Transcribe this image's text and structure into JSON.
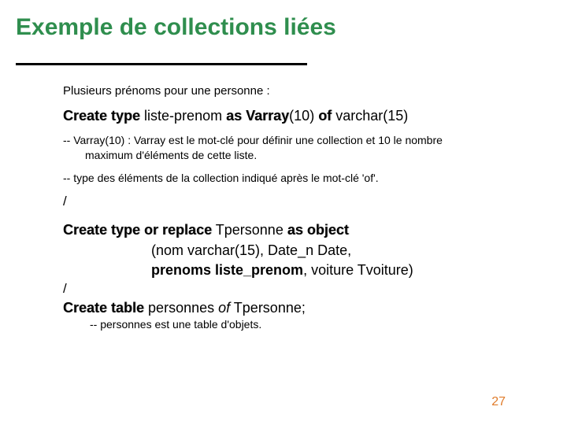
{
  "title": "Exemple de collections liées",
  "intro": "Plusieurs prénoms pour une personne :",
  "stmt1": {
    "create_type": "Create type",
    "name": " liste-prenom ",
    "as_varray": "as Varray",
    "size": "(10) ",
    "of": "of",
    "datatype": " varchar(15)"
  },
  "comment1a": "-- Varray(10) : Varray est le mot-clé pour définir une collection et 10 le nombre",
  "comment1b": "maximum d'éléments de cette liste.",
  "comment2": "-- type des éléments de la collection indiqué après le mot-clé 'of'.",
  "slash1": "/",
  "stmt2": {
    "create_type_or_replace": "Create type or replace",
    "name": " Tpersonne ",
    "as_object": "as object",
    "line2": "(nom varchar(15), Date_n Date,",
    "line3a": "prenoms liste_prenom",
    "line3b": ", voiture Tvoiture)"
  },
  "slash2": "/",
  "stmt3": {
    "create_table": "Create table",
    "name": " personnes ",
    "of": "of",
    "type": " Tpersonne;"
  },
  "comment3": "-- personnes est une table d'objets.",
  "page_number": "27"
}
